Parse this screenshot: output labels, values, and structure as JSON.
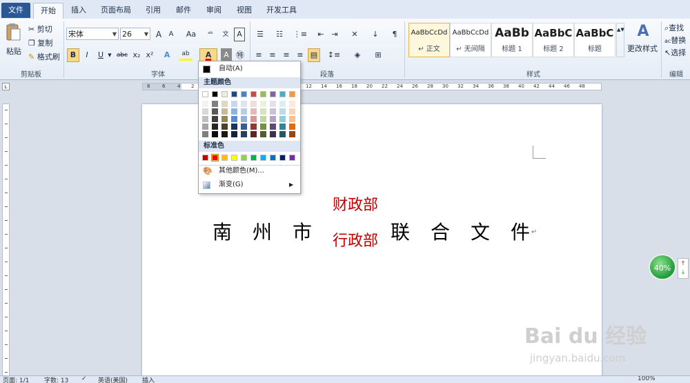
{
  "tabs": [
    {
      "label": "文件"
    },
    {
      "label": "开始"
    },
    {
      "label": "插入"
    },
    {
      "label": "页面布局"
    },
    {
      "label": "引用"
    },
    {
      "label": "邮件"
    },
    {
      "label": "审阅"
    },
    {
      "label": "视图"
    },
    {
      "label": "开发工具"
    }
  ],
  "clipboard": {
    "paste": "粘贴",
    "cut": "剪切",
    "copy": "复制",
    "format_painter": "格式刷",
    "group": "剪贴板"
  },
  "font": {
    "name": "宋体",
    "size": "26",
    "group": "字体",
    "bold": "B",
    "italic": "I",
    "underline": "U",
    "strike": "abc",
    "subscript": "x₂",
    "superscript": "x²",
    "font_color_letter": "A",
    "grow": "A",
    "shrink": "A",
    "case": "Aa"
  },
  "paragraph": {
    "group": "段落"
  },
  "styles": {
    "group": "样式",
    "items": [
      {
        "preview": "AaBbCcDd",
        "name": "↵ 正文"
      },
      {
        "preview": "AaBbCcDd",
        "name": "↵ 无间隔"
      },
      {
        "preview": "AaBb",
        "name": "标题 1"
      },
      {
        "preview": "AaBbC",
        "name": "标题 2"
      },
      {
        "preview": "AaBbC",
        "name": "标题"
      }
    ],
    "change": "更改样式"
  },
  "editing": {
    "group": "编辑",
    "find": "查找",
    "replace": "替换",
    "select": "选择"
  },
  "ruler_numbers_h": [
    "8",
    "6",
    "4",
    "2",
    "12",
    "14",
    "16",
    "18",
    "20",
    "22",
    "24",
    "26",
    "28",
    "30",
    "32",
    "34",
    "36",
    "38",
    "40",
    "42",
    "44",
    "46",
    "48"
  ],
  "document": {
    "chars": [
      "南",
      "州",
      "市",
      "联",
      "合",
      "文",
      "件"
    ],
    "dept_top": "财政部",
    "dept_bottom": "行政部",
    "para_mark": "↵"
  },
  "color_menu": {
    "auto": "自动(A)",
    "theme_header": "主题颜色",
    "standard_header": "标准色",
    "more": "其他颜色(M)...",
    "gradient": "渐变(G)",
    "theme_top": [
      "#ffffff",
      "#000000",
      "#eeece1",
      "#1f497d",
      "#4f81bd",
      "#c0504d",
      "#9bbb59",
      "#8064a2",
      "#4bacc6",
      "#f79646"
    ],
    "theme_columns": [
      [
        "#f2f2f2",
        "#d8d8d8",
        "#bfbfbf",
        "#a5a5a5",
        "#7f7f7f"
      ],
      [
        "#7f7f7f",
        "#595959",
        "#3f3f3f",
        "#262626",
        "#0c0c0c"
      ],
      [
        "#ddd9c3",
        "#c4bd97",
        "#938953",
        "#494429",
        "#1d1b10"
      ],
      [
        "#c6d9f0",
        "#8db3e2",
        "#548dd4",
        "#17365d",
        "#0f243e"
      ],
      [
        "#dbe5f1",
        "#b8cce4",
        "#95b3d7",
        "#366092",
        "#244061"
      ],
      [
        "#f2dcdb",
        "#e5b9b7",
        "#d99694",
        "#953734",
        "#632423"
      ],
      [
        "#ebf1dd",
        "#d7e3bc",
        "#c3d69b",
        "#76923c",
        "#4f6128"
      ],
      [
        "#e5e0ec",
        "#ccc1d9",
        "#b2a2c7",
        "#5f497a",
        "#3f3151"
      ],
      [
        "#dbeef3",
        "#b7dde8",
        "#92cddc",
        "#31859b",
        "#205867"
      ],
      [
        "#fdeada",
        "#fbd5b5",
        "#fac08f",
        "#e36c09",
        "#974806"
      ]
    ],
    "standard": [
      "#c00000",
      "#ff0000",
      "#ffc000",
      "#ffff00",
      "#92d050",
      "#00b050",
      "#00b0f0",
      "#0070c0",
      "#002060",
      "#7030a0"
    ]
  },
  "status": {
    "page": "页面: 1/1",
    "words": "字数: 13",
    "lang": "英语(美国)",
    "mode": "插入",
    "zoom_pct": "100%"
  },
  "zoom_badge": "40%",
  "watermark": {
    "brand": "Bai du 经验",
    "url": "jingyan.baidu.com"
  }
}
